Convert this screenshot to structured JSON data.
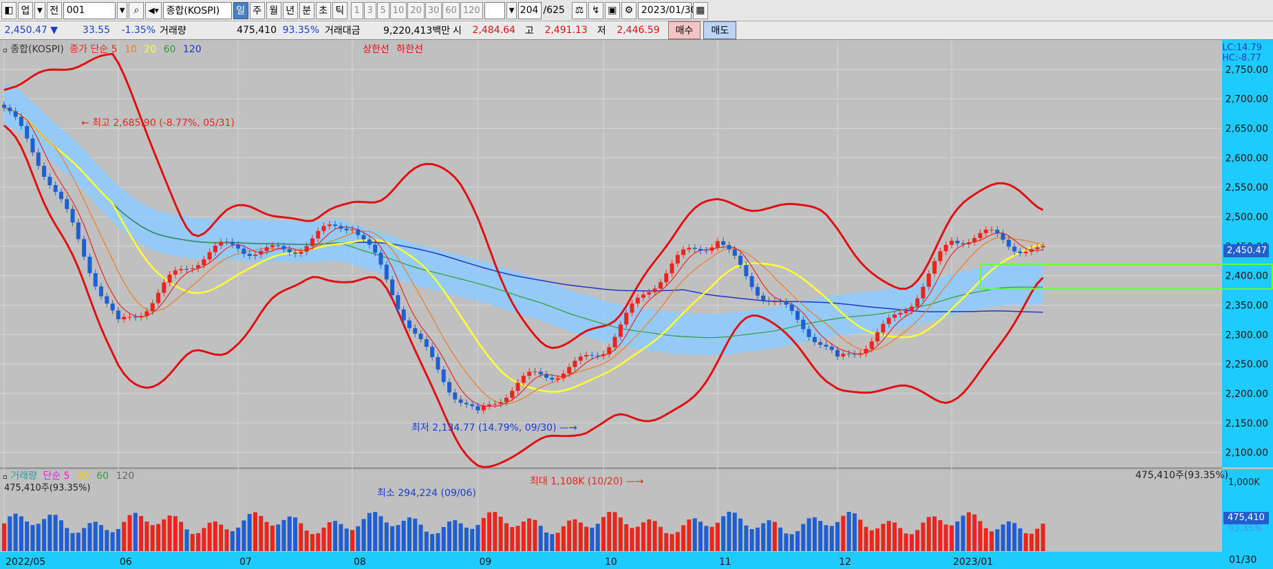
{
  "toolbar": {
    "type_label": "업",
    "prev_label": "전",
    "code": "001",
    "name": "종합(KOSPI)",
    "periods": [
      "일",
      "주",
      "월",
      "년",
      "분",
      "초",
      "틱"
    ],
    "active_period": "일",
    "minutes": [
      "1",
      "3",
      "5",
      "10",
      "20",
      "30",
      "60",
      "120"
    ],
    "count": "204",
    "total": "/625",
    "date": "2023/01/30"
  },
  "info": {
    "price": "2,450.47 ▼",
    "change": "33.55",
    "change_pct": "-1.35%",
    "volume_label": "거래량",
    "volume": "475,410",
    "volume_pct": "93.35%",
    "amount_label": "거래대금",
    "amount": "9,220,413백만",
    "open_label": "시",
    "open": "2,484.64",
    "high_label": "고",
    "high": "2,491.13",
    "low_label": "저",
    "low": "2,446.59",
    "buy_label": "매수",
    "sell_label": "매도"
  },
  "legend": {
    "name": "종합(KOSPI)",
    "ma_prefix": "종가 단순",
    "ma_5": "5",
    "ma_10": "10",
    "ma_20": "20",
    "ma_60": "60",
    "ma_120": "120",
    "upper_limit": "상한선",
    "lower_limit": "하한선"
  },
  "volume_legend": {
    "name": "거래량",
    "ma_prefix": "단순",
    "ma_5": "5",
    "ma_20": "20",
    "ma_60": "60",
    "ma_120": "120",
    "current": "475,410주(93.35%)"
  },
  "annotations": {
    "high": "최고 2,685.90 (-8.77%, 05/31)",
    "low": "최저 2,134.77 (14.79%, 09/30)",
    "vol_min": "최소 294,224 (09/06)",
    "vol_max": "최대 1,108K (10/20)",
    "lc": "LC:14.79",
    "hc": "HC:-8.77",
    "price_tag": "2,450.47",
    "vol_tag": "475,410",
    "vol_pct_tag": "93.35%",
    "vol_axis_max": "1,000K",
    "vol_right_top": "475,410주(93.35%)",
    "last_date": "01/30"
  },
  "colors": {
    "up": "#e8261d",
    "down": "#1f5fd0",
    "ma5": "#e8261d",
    "ma10": "#f07a20",
    "ma20": "#ffff33",
    "ma60": "#2f9a3c",
    "ma120": "#2233cc",
    "cloud": "#8ecbff",
    "band": "#e01010",
    "bg": "#c0c0c0",
    "axis_bg": "#1ecbff",
    "box": "#66ff33"
  },
  "chart_data": [
    {
      "type": "candlestick",
      "title": "종합(KOSPI)",
      "y_ticks": [
        "2,750.00",
        "2,700.00",
        "2,650.00",
        "2,600.00",
        "2,550.00",
        "2,500.00",
        "2,450.00",
        "2,400.00",
        "2,350.00",
        "2,300.00",
        "2,250.00",
        "2,200.00",
        "2,150.00",
        "2,100.00"
      ],
      "ylim": [
        2075,
        2800
      ],
      "x_ticks": [
        "2022/05",
        "06",
        "07",
        "08",
        "09",
        "10",
        "11",
        "12",
        "2023/01"
      ],
      "monthly_close": [
        {
          "x": "2022/05",
          "close": 2685
        },
        {
          "x": "06",
          "close": 2332
        },
        {
          "x": "07",
          "close": 2451
        },
        {
          "x": "08",
          "close": 2472
        },
        {
          "x": "09",
          "close": 2155
        },
        {
          "x": "10",
          "close": 2293
        },
        {
          "x": "11",
          "close": 2472
        },
        {
          "x": "12",
          "close": 2236
        },
        {
          "x": "2023/01",
          "close": 2450.47
        }
      ],
      "last": {
        "open": 2484.64,
        "high": 2491.13,
        "low": 2446.59,
        "close": 2450.47
      },
      "period_high": 2685.9,
      "period_low": 2134.77,
      "legend": [
        "종가 단순 5",
        "10",
        "20",
        "60",
        "120",
        "상한선",
        "하한선"
      ]
    },
    {
      "type": "bar",
      "title": "거래량",
      "y_ticks": [
        "1,000K"
      ],
      "last_volume": 475410,
      "max_volume": 1108000,
      "min_volume": 294224
    }
  ]
}
